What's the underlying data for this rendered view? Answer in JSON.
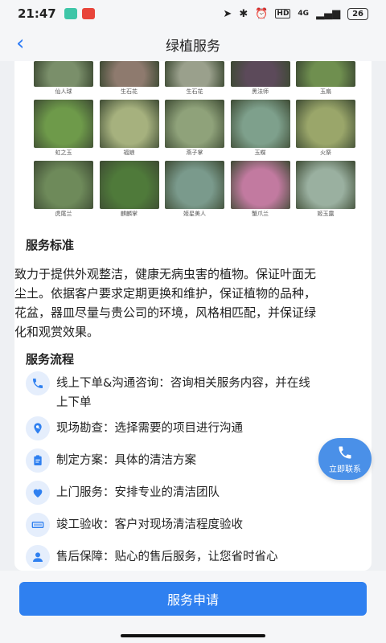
{
  "status_bar": {
    "time": "21:47",
    "network": "4G",
    "battery": "26"
  },
  "nav": {
    "title": "绿植服务"
  },
  "plants": {
    "row0": [
      {
        "caption": "仙人球",
        "color": "#7a8f6a"
      },
      {
        "caption": "生石花",
        "color": "#8e7a6e"
      },
      {
        "caption": "生石花",
        "color": "#9aa08c"
      },
      {
        "caption": "黑法师",
        "color": "#5c4a5a"
      },
      {
        "caption": "玉扇",
        "color": "#6f8f4f"
      }
    ],
    "row1": [
      {
        "caption": "虹之玉",
        "color": "#6e9a4a"
      },
      {
        "caption": "福娘",
        "color": "#a6b17e"
      },
      {
        "caption": "燕子掌",
        "color": "#8fa27a"
      },
      {
        "caption": "玉蝶",
        "color": "#7ea08c"
      },
      {
        "caption": "火祭",
        "color": "#9aa66a"
      }
    ],
    "row2": [
      {
        "caption": "虎尾兰",
        "color": "#6e8a5a"
      },
      {
        "caption": "麒麟掌",
        "color": "#4f7a3a"
      },
      {
        "caption": "姬星美人",
        "color": "#7a9a8c"
      },
      {
        "caption": "蟹爪兰",
        "color": "#c27aa0"
      },
      {
        "caption": "姬玉露",
        "color": "#9ab0a0"
      }
    ]
  },
  "standard": {
    "title": "服务标准",
    "text_lines": [
      "致力于提供外观整洁，健康无病虫害的植物。保证叶面无",
      "尘土。依据客户要求定期更换和维护，保证植物的品种，",
      "花盆，器皿尽量与贵公司的环境，风格相匹配，并保证绿",
      "化和观赏效果。"
    ]
  },
  "process": {
    "title": "服务流程",
    "steps": [
      {
        "icon": "phone-icon",
        "line1": "线上下单&沟通咨询：咨询相关服务内容，并在线",
        "line2": "上下单"
      },
      {
        "icon": "search-icon",
        "line1": "现场勘查：选择需要的项目进行沟通",
        "line2": ""
      },
      {
        "icon": "clipboard-icon",
        "line1": "制定方案：具体的清洁方案",
        "line2": ""
      },
      {
        "icon": "heart-icon",
        "line1": "上门服务：安排专业的清洁团队",
        "line2": ""
      },
      {
        "icon": "scanner-icon",
        "line1": "竣工验收：客户对现场清洁程度验收",
        "line2": ""
      },
      {
        "icon": "person-icon",
        "line1": "售后保障：贴心的售后服务，让您省时省心",
        "line2": ""
      }
    ]
  },
  "contact": {
    "label": "立即联系"
  },
  "apply": {
    "label": "服务申请"
  },
  "colors": {
    "accent": "#2f80f0",
    "icon_bg": "#e5eefc"
  }
}
